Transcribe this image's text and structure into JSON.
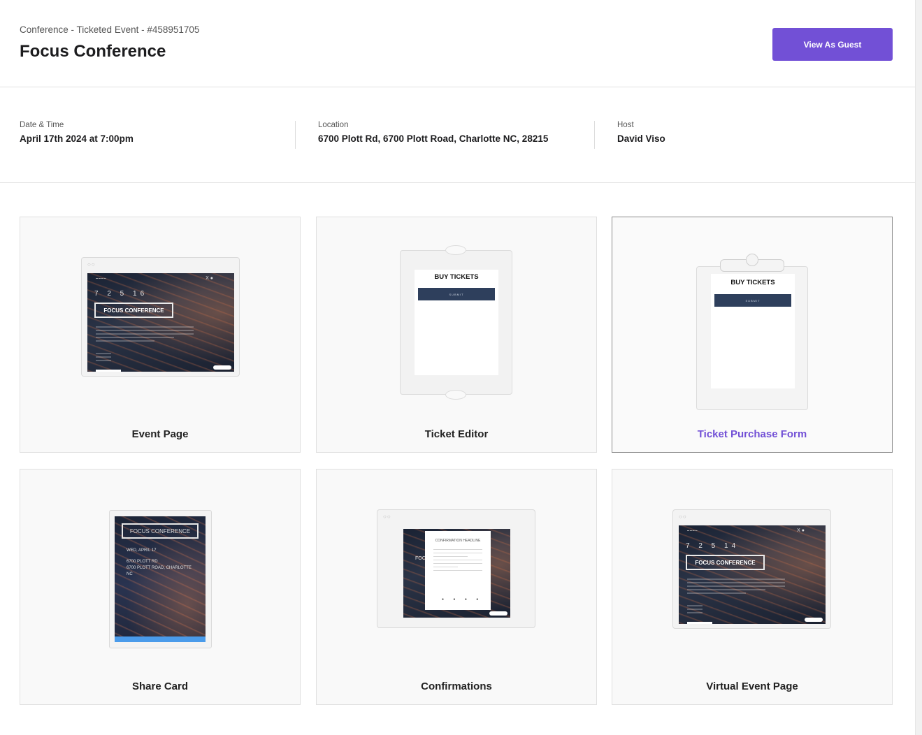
{
  "header": {
    "breadcrumb": "Conference - Ticketed Event - #458951705",
    "title": "Focus Conference",
    "view_as_guest_label": "View As Guest",
    "accent_color": "#7250d6"
  },
  "info": {
    "date_label": "Date & Time",
    "date_value": "April 17th 2024 at 7:00pm",
    "location_label": "Location",
    "location_value": "6700 Plott Rd, 6700 Plott Road, Charlotte NC, 28215",
    "host_label": "Host",
    "host_value": "David Viso"
  },
  "cards": [
    {
      "label": "Event Page",
      "preview": {
        "countdown": "7 2 5 16",
        "event_title": "FOCUS CONFERENCE"
      }
    },
    {
      "label": "Ticket Editor",
      "preview": {
        "heading": "BUY TICKETS",
        "button": "SUBMIT"
      }
    },
    {
      "label": "Ticket Purchase Form",
      "active": true,
      "preview": {
        "heading": "BUY TICKETS",
        "button": "SUBMIT"
      }
    },
    {
      "label": "Share Card",
      "preview": {
        "event_title": "FOCUS CONFERENCE",
        "date": "WED, APRIL 17",
        "address_line1": "6700 PLOTT RD",
        "address_line2": "6700 PLOTT ROAD, CHARLOTTE",
        "address_line3": "NC"
      }
    },
    {
      "label": "Confirmations",
      "preview": {
        "heading": "CONFIRMATION HEADLINE",
        "partial_title": "FOC"
      }
    },
    {
      "label": "Virtual Event Page",
      "preview": {
        "countdown": "7 2 5 14",
        "event_title": "FOCUS CONFERENCE"
      }
    }
  ]
}
